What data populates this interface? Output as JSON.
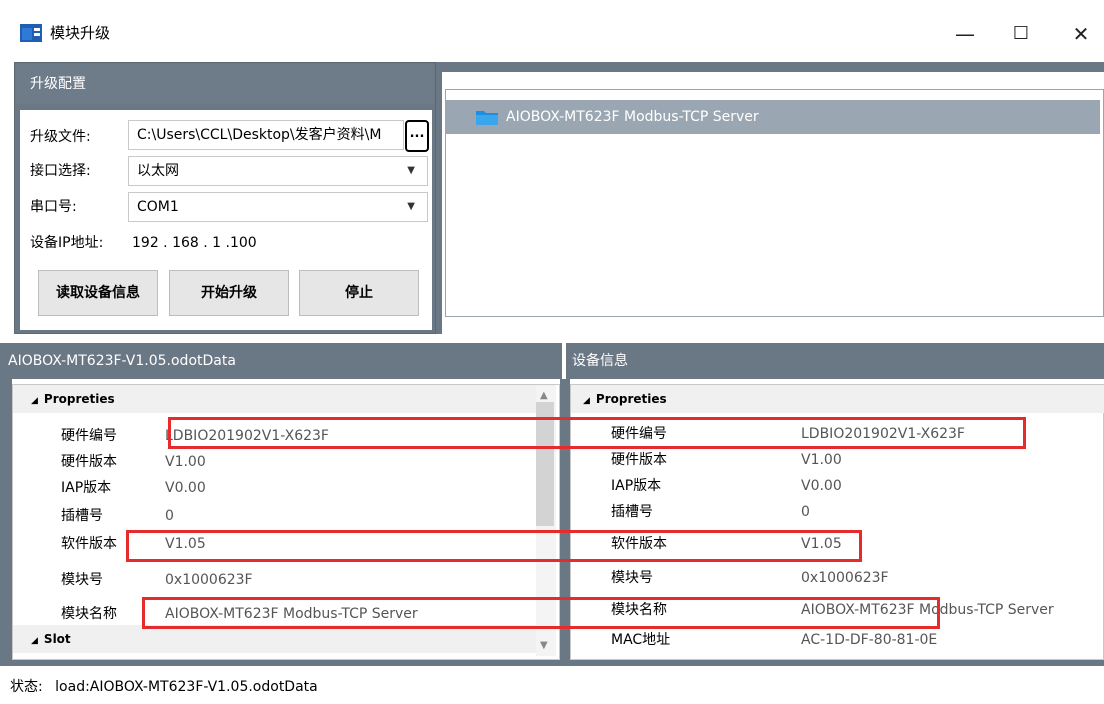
{
  "window": {
    "title": "模块升级",
    "minimize": "—",
    "maximize": "☐",
    "close": "✕"
  },
  "config": {
    "header": "升级配置",
    "file_label": "升级文件:",
    "file_value": "C:\\Users\\CCL\\Desktop\\发客户资料\\M",
    "browse": "...",
    "interface_label": "接口选择:",
    "interface_value": "以太网",
    "serial_label": "串口号:",
    "serial_value": "COM1",
    "ip_label": "设备IP地址:",
    "ip_value": "192 . 168 .  1  .100",
    "btn_read": "读取设备信息",
    "btn_start": "开始升级",
    "btn_stop": "停止"
  },
  "tree": {
    "item": "AIOBOX-MT623F Modbus-TCP Server"
  },
  "left_panel": {
    "header": "AIOBOX-MT623F-V1.05.odotData",
    "section1": "Propreties",
    "section2": "Slot",
    "rows": [
      {
        "key": "硬件编号",
        "value": "LDBIO201902V1-X623F"
      },
      {
        "key": "硬件版本",
        "value": "V1.00"
      },
      {
        "key": "IAP版本",
        "value": "V0.00"
      },
      {
        "key": "插槽号",
        "value": "0"
      },
      {
        "key": "软件版本",
        "value": "V1.05"
      },
      {
        "key": "模块号",
        "value": "0x1000623F"
      },
      {
        "key": "模块名称",
        "value": "AIOBOX-MT623F Modbus-TCP Server"
      }
    ]
  },
  "right_panel": {
    "header": "设备信息",
    "section1": "Propreties",
    "rows": [
      {
        "key": "硬件编号",
        "value": "LDBIO201902V1-X623F"
      },
      {
        "key": "硬件版本",
        "value": "V1.00"
      },
      {
        "key": "IAP版本",
        "value": "V0.00"
      },
      {
        "key": "插槽号",
        "value": "0"
      },
      {
        "key": "软件版本",
        "value": "V1.05"
      },
      {
        "key": "模块号",
        "value": "0x1000623F"
      },
      {
        "key": "模块名称",
        "value": "AIOBOX-MT623F Modbus-TCP Server"
      },
      {
        "key": "MAC地址",
        "value": "AC-1D-DF-80-81-0E"
      }
    ]
  },
  "status": {
    "label": "状态:",
    "value": "load:AIOBOX-MT623F-V1.05.odotData"
  },
  "colors": {
    "panel": "#6a7785",
    "highlight": "#e52b2b",
    "selection": "#9aa7b3"
  }
}
